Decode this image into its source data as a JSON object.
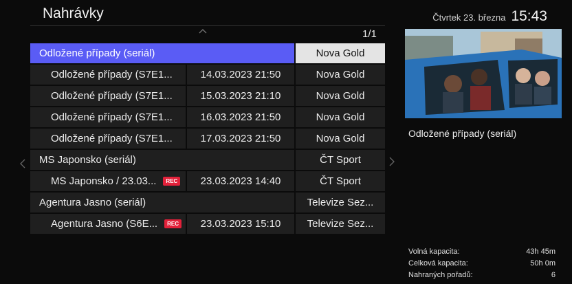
{
  "header": {
    "title": "Nahrávky",
    "date": "Čtvrtek 23. března",
    "time": "15:43"
  },
  "pager": {
    "page": "1/1"
  },
  "list": [
    {
      "type": "group",
      "title": "Odložené případy (seriál)",
      "date": "",
      "channel": "Nova Gold",
      "rec": false,
      "selected": true
    },
    {
      "type": "item",
      "title": "Odložené případy (S7E1...",
      "date": "14.03.2023 21:50",
      "channel": "Nova Gold",
      "rec": false
    },
    {
      "type": "item",
      "title": "Odložené případy (S7E1...",
      "date": "15.03.2023 21:10",
      "channel": "Nova Gold",
      "rec": false
    },
    {
      "type": "item",
      "title": "Odložené případy (S7E1...",
      "date": "16.03.2023 21:50",
      "channel": "Nova Gold",
      "rec": false
    },
    {
      "type": "item",
      "title": "Odložené případy (S7E1...",
      "date": "17.03.2023 21:50",
      "channel": "Nova Gold",
      "rec": false
    },
    {
      "type": "group",
      "title": "MS Japonsko (seriál)",
      "date": "",
      "channel": "ČT Sport",
      "rec": false
    },
    {
      "type": "item",
      "title": "MS Japonsko / 23.03...",
      "date": "23.03.2023 14:40",
      "channel": "ČT Sport",
      "rec": true
    },
    {
      "type": "group",
      "title": "Agentura Jasno (seriál)",
      "date": "",
      "channel": "Televize Sez...",
      "rec": false
    },
    {
      "type": "item",
      "title": "Agentura Jasno (S6E...",
      "date": "23.03.2023 15:10",
      "channel": "Televize Sez...",
      "rec": true
    }
  ],
  "rec_badge": "REC",
  "preview": {
    "title": "Odložené případy (seriál)"
  },
  "stats": {
    "free_label": "Volná kapacita:",
    "free_value": "43h 45m",
    "total_label": "Celková kapacita:",
    "total_value": "50h 0m",
    "count_label": "Nahraných pořadů:",
    "count_value": "6"
  },
  "colors": {
    "accent": "#5a5cf5",
    "rec": "#e3213a"
  }
}
